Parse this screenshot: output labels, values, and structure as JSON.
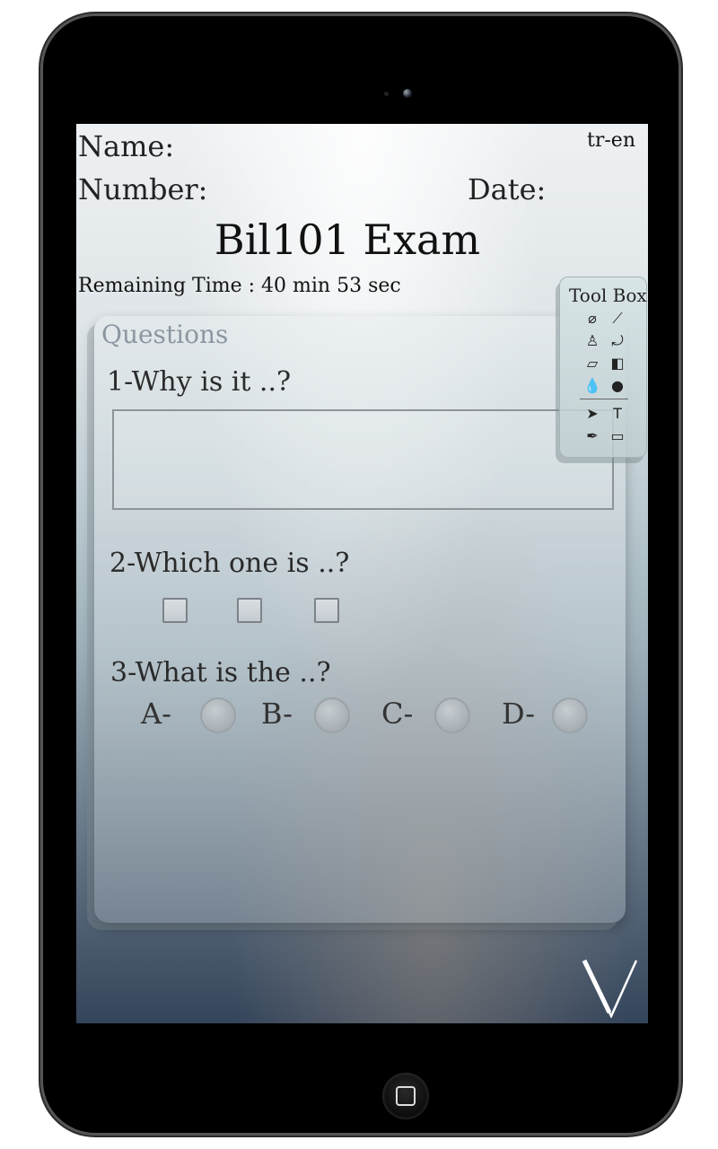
{
  "header": {
    "language": "tr-en",
    "name_label": "Name:",
    "number_label": "Number:",
    "date_label": "Date:",
    "title": "Bil101 Exam",
    "remaining_time": "Remaining Time : 40 min 53 sec"
  },
  "questions_panel": {
    "title": "Questions",
    "q1": {
      "text": "1-Why is it ..?",
      "answer": ""
    },
    "q2": {
      "text": "2-Which one is ..?",
      "checkboxes": 3
    },
    "q3": {
      "text": "3-What is the ..?",
      "options": [
        "A-",
        "B-",
        "C-",
        "D-"
      ]
    }
  },
  "toolbox": {
    "title": "Tool Box",
    "tools": [
      "healing-brush-icon",
      "brush-icon",
      "stamp-icon",
      "history-brush-icon",
      "eraser-icon",
      "gradient-icon",
      "blur-icon",
      "dodge-icon",
      "selection-arrow-icon",
      "text-tool-icon",
      "pen-icon",
      "rectangle-shape-icon"
    ]
  },
  "colors": {
    "frame": "#000000",
    "screen_top": "#eef1f3",
    "screen_bottom": "#34445a"
  }
}
